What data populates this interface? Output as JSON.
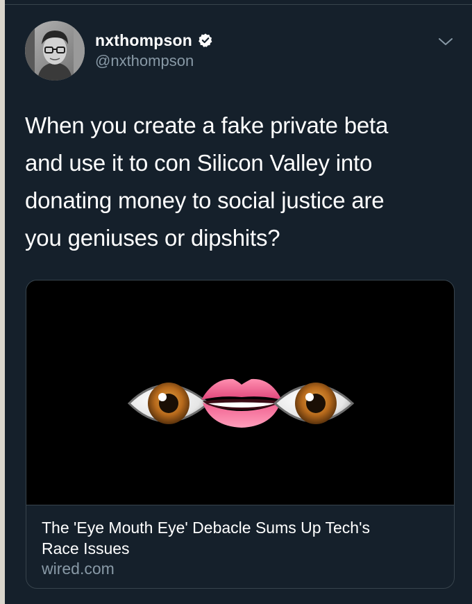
{
  "tweet": {
    "display_name": "nxthompson",
    "handle": "@nxthompson",
    "verified": true,
    "text_lines": [
      "When you create a fake private beta",
      "and use it to con Silicon Valley into",
      "donating money to social justice are",
      "you geniuses or dipshits?"
    ]
  },
  "card": {
    "image_icons": [
      "eye-icon",
      "mouth-icon",
      "eye-icon"
    ],
    "title_lines": [
      "The 'Eye Mouth Eye' Debacle Sums Up Tech's",
      "Race Issues"
    ],
    "domain": "wired.com"
  },
  "colors": {
    "background": "#15202b",
    "verified_badge": "#ffffff",
    "secondary_text": "#8899a6",
    "border": "#38444d"
  }
}
